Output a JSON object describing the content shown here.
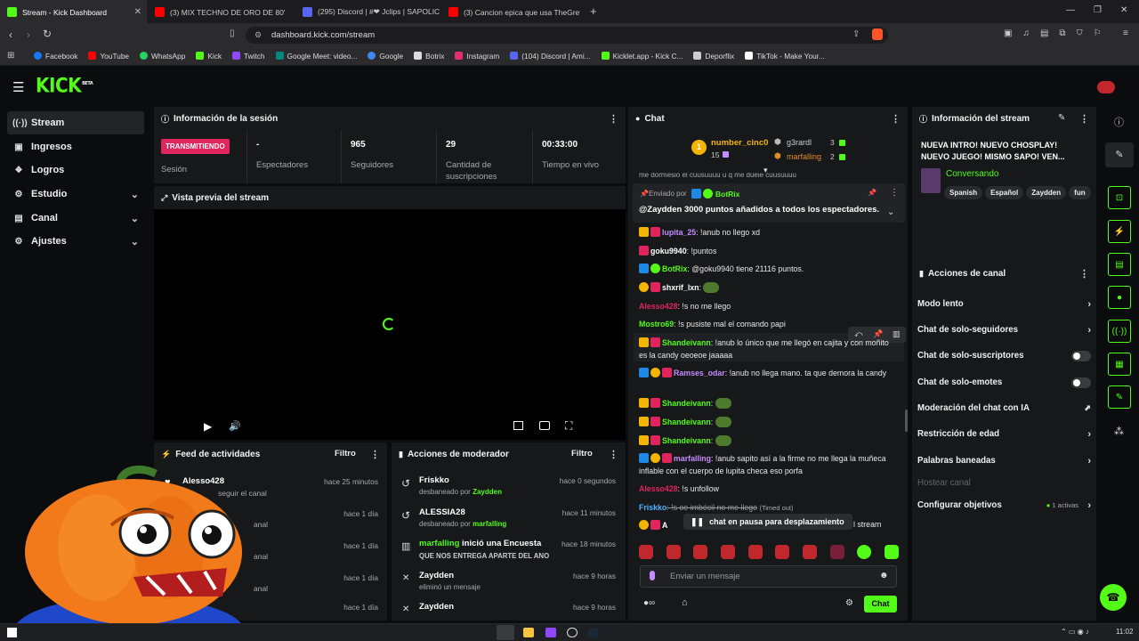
{
  "browser": {
    "tabs": [
      {
        "title": "Stream - Kick Dashboard",
        "color": "#53fc18"
      },
      {
        "title": "(3) MIX TECHNO DE ORO DE 80'",
        "color": "#ff0000"
      },
      {
        "title": "(295) Discord | #❤ Jclips | SAPOLIC",
        "color": "#5865f2"
      },
      {
        "title": "(3) Cancion epica que usa TheGrefg",
        "color": "#ff0000"
      }
    ],
    "url": "dashboard.kick.com/stream",
    "bookmarks": [
      {
        "label": "Facebook",
        "color": "#1877f2"
      },
      {
        "label": "YouTube",
        "color": "#ff0000"
      },
      {
        "label": "WhatsApp",
        "color": "#25d366"
      },
      {
        "label": "Kick",
        "color": "#53fc18"
      },
      {
        "label": "Twitch",
        "color": "#9146ff"
      },
      {
        "label": "Google Meet: video...",
        "color": "#00897b"
      },
      {
        "label": "Google",
        "color": "#4285f4"
      },
      {
        "label": "Botrix",
        "color": "#dddddd"
      },
      {
        "label": "Instagram",
        "color": "#e1306c"
      },
      {
        "label": "(104) Discord | Ami...",
        "color": "#5865f2"
      },
      {
        "label": "Kicklet.app - Kick C...",
        "color": "#53fc18"
      },
      {
        "label": "Deporflix",
        "color": "#cccccc"
      },
      {
        "label": "TikTok - Make Your...",
        "color": "#ffffff"
      }
    ]
  },
  "app": {
    "logo": "KICK",
    "logo_sup": "BETA",
    "accent": "#53fc18"
  },
  "nav": {
    "items": [
      {
        "label": "Stream",
        "icon": "broadcast-icon",
        "glyph": "((·))"
      },
      {
        "label": "Ingresos",
        "icon": "wallet-icon",
        "glyph": "▣"
      },
      {
        "label": "Logros",
        "icon": "trophy-icon",
        "glyph": "❖"
      },
      {
        "label": "Estudio",
        "icon": "studio-icon",
        "glyph": "⚙"
      },
      {
        "label": "Canal",
        "icon": "channel-icon",
        "glyph": "▤"
      },
      {
        "label": "Ajustes",
        "icon": "settings-icon",
        "glyph": "⚙"
      }
    ]
  },
  "session": {
    "title": "Información de la sesión",
    "live_badge": "TRANSMITIENDO",
    "stats": [
      {
        "value": "",
        "label": "Sesión"
      },
      {
        "value": "-",
        "label": "Espectadores"
      },
      {
        "value": "965",
        "label": "Seguidores"
      },
      {
        "value": "29",
        "label": "Cantidad de suscripciones"
      },
      {
        "value": "00:33:00",
        "label": "Tiempo en vivo"
      }
    ]
  },
  "preview": {
    "title": "Vista previa del stream"
  },
  "feed": {
    "title": "Feed de actividades",
    "filter": "Filtro",
    "items": [
      {
        "user": "Alesso428",
        "desc": "seguir el canal",
        "time": "hace 25 minutos"
      },
      {
        "user": "",
        "desc": "anal",
        "time": "hace 1 día"
      },
      {
        "user": "",
        "desc": "anal",
        "time": "hace 1 día"
      },
      {
        "user": "",
        "desc": "anal",
        "time": "hace 1 día"
      },
      {
        "user": "",
        "desc": "",
        "time": "hace 1 día"
      }
    ]
  },
  "mod": {
    "title": "Acciones de moderador",
    "filter": "Filtro",
    "items": [
      {
        "user": "Friskko",
        "desc": "desbaneado por ",
        "by": "Zaydden",
        "time": "hace 0 segundos",
        "icon": "undo-icon",
        "glyph": "↺"
      },
      {
        "user": "ALESSIA28",
        "desc": "desbaneado por ",
        "by": "marfalling",
        "time": "hace 11 minutos",
        "icon": "undo-icon",
        "glyph": "↺"
      },
      {
        "user": "marfalling",
        "extra": " inició una Encuesta",
        "desc": "QUE NOS ENTREGA APARTE DEL ANO",
        "by": "",
        "time": "hace 18 minutos",
        "icon": "poll-icon",
        "glyph": "▥"
      },
      {
        "user": "Zaydden",
        "desc": "eliminó un mensaje",
        "by": "",
        "time": "hace 9 horas",
        "icon": "trash-icon",
        "glyph": "✕"
      },
      {
        "user": "Zaydden",
        "desc": "",
        "by": "",
        "time": "hace 9 horas",
        "icon": "trash-icon",
        "glyph": "✕"
      }
    ]
  },
  "chat": {
    "title": "Chat",
    "leaderboard": [
      {
        "name": "number_cinc0",
        "count": "15"
      },
      {
        "name": "g3rardl",
        "count": "3"
      },
      {
        "name": "marfalling",
        "count": "2"
      }
    ],
    "partial_top": "me dormesio el        cuusuuuu u q me dueie cuusuuuu",
    "pinned": {
      "label": "Enviado por",
      "by": "BotRix",
      "text": "@Zaydden 3000 puntos añadidos a todos los espectadores."
    },
    "messages": [
      {
        "user": "lupita_25",
        "color": "#c58bff",
        "text": ": !anub no llego xd"
      },
      {
        "user": "goku9940",
        "color": "#ffffff",
        "text": ": !puntos"
      },
      {
        "user": "BotRix",
        "color": "#53fc18",
        "text": ": @goku9940 tiene 21116 puntos."
      },
      {
        "user": "shxrif_lxn",
        "color": "#ffffff",
        "text": ":"
      },
      {
        "user": "Alesso428",
        "color": "#e0245e",
        "text": ": !s no me llego"
      },
      {
        "user": "Mostro69",
        "color": "#53fc18",
        "text": ": !s pusiste mal el comando papi"
      },
      {
        "user": "Shandeivann",
        "color": "#53fc18",
        "text": ": !anub lo único que me llegó en cajita y con moñito es la candy oeoeoe jaaaaa"
      },
      {
        "user": "Ramses_odar",
        "color": "#c58bff",
        "text": ": !anub no llega mano. ta que demora la candy"
      },
      {
        "user": "Shandeivann",
        "color": "#53fc18",
        "text": ":"
      },
      {
        "user": "Shandeivann",
        "color": "#53fc18",
        "text": ":"
      },
      {
        "user": "Shandeivann",
        "color": "#53fc18",
        "text": ":"
      },
      {
        "user": "marfalling",
        "color": "#c58bff",
        "text": ": !anub sapito así a la firme no me llega la muñeca inflable con el cuerpo de lupita checa eso porfa"
      },
      {
        "user": "Alesso428",
        "color": "#e0245e",
        "text": ": !s unfollow"
      },
      {
        "user": "Friskko",
        "color": "#4fb3ff",
        "text": ": !s oe imbécil no me llego",
        "note": "(Timed out)"
      }
    ],
    "paused": "chat en pausa para desplazamiento",
    "paused_tail": "l stream",
    "input_placeholder": "Enviar un mensaje",
    "send": "Chat"
  },
  "streaminfo": {
    "title": "Información del stream",
    "stream_title": "NUEVA INTRO! NUEVO CHOSPLAY! NUEVO JUEGO! MISMO SAPO! VEN...",
    "category": "Conversando",
    "tags": [
      "Spanish",
      "Español",
      "Zaydden",
      "fun"
    ]
  },
  "actions": {
    "title": "Acciones de canal",
    "items": [
      {
        "label": "Modo lento",
        "type": "arrow"
      },
      {
        "label": "Chat de solo-seguidores",
        "type": "arrow"
      },
      {
        "label": "Chat de solo-suscriptores",
        "type": "toggle"
      },
      {
        "label": "Chat de solo-emotes",
        "type": "toggle"
      },
      {
        "label": "Moderación del chat con IA",
        "type": "link"
      },
      {
        "label": "Restricción de edad",
        "type": "arrow"
      },
      {
        "label": "Palabras baneadas",
        "type": "arrow"
      },
      {
        "label": "Hostear canal",
        "type": "disabled"
      },
      {
        "label": "Configurar objetivos",
        "type": "arrow",
        "extra": "1 activas"
      }
    ]
  },
  "taskbar": {
    "time": "11:02"
  }
}
